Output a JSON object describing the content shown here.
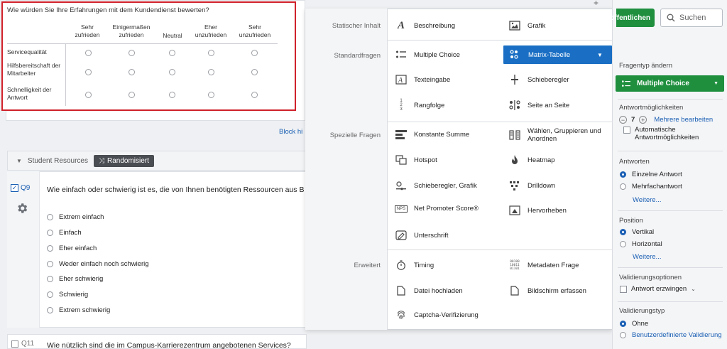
{
  "toolbar": {
    "publish_label": "öffentlichen",
    "search_label": "Suchen"
  },
  "preview": {
    "question": "Wie würden Sie Ihre Erfahrungen mit dem Kundendienst bewerten?",
    "columns": [
      "Sehr zufrieden",
      "Einigermaßen zufrieden",
      "Neutral",
      "Eher unzufrieden",
      "Sehr unzufrieden"
    ],
    "rows": [
      "Servicequalität",
      "Hilfsbereitschaft der Mitarbeiter",
      "Schnelligkeit der Antwort"
    ]
  },
  "background_survey": {
    "block_link": "Block hi",
    "block_title": "Student Resources",
    "randomized_label": "Randomisiert",
    "q9": {
      "number": "Q9",
      "text": "Wie einfach oder schwierig ist es, die von Ihnen benötigten Ressourcen aus Bibliothekssystem zu beziehen?",
      "options": [
        "Extrem einfach",
        "Einfach",
        "Eher einfach",
        "Weder einfach noch schwierig",
        "Eher schwierig",
        "Schwierig",
        "Extrem schwierig"
      ]
    },
    "q11": {
      "number": "Q11",
      "text": "Wie nützlich sind die im Campus-Karrierezentrum angebotenen Services?"
    }
  },
  "question_type_panel": {
    "categories": {
      "static": "Statischer Inhalt",
      "standard": "Standardfragen",
      "special": "Spezielle Fragen",
      "advanced": "Erweitert"
    },
    "static_items": [
      "Beschreibung",
      "Grafik"
    ],
    "standard_items": [
      "Multiple Choice",
      "Matrix-Tabelle",
      "Texteingabe",
      "Schieberegler",
      "Rangfolge",
      "Seite an Seite"
    ],
    "special_items": [
      "Konstante Summe",
      "Wählen, Gruppieren und Anordnen",
      "Hotspot",
      "Heatmap",
      "Schieberegler, Grafik",
      "Drilldown",
      "Net Promoter Score®",
      "Hervorheben",
      "Unterschrift"
    ],
    "advanced_items": [
      "Timing",
      "Metadaten Frage",
      "Datei hochladen",
      "Bildschirm erfassen",
      "Captcha-Verifizierung"
    ],
    "selected": "Matrix-Tabelle"
  },
  "sidebar": {
    "question_type_label": "Fragentyp ändern",
    "question_type_value": "Multiple Choice",
    "choices_label": "Antwortmöglichkeiten",
    "choices_count": "7",
    "edit_multiple": "Mehrere bearbeiten",
    "auto_choices": "Automatische Antwortmöglichkeiten",
    "answers_label": "Antworten",
    "single_answer": "Einzelne Antwort",
    "multiple_answer": "Mehrfachantwort",
    "more1": "Weitere...",
    "position_label": "Position",
    "vertical": "Vertikal",
    "horizontal": "Horizontal",
    "more2": "Weitere...",
    "validation_options_label": "Validierungsoptionen",
    "force_answer": "Antwort erzwingen",
    "validation_type_label": "Validierungstyp",
    "none": "Ohne",
    "custom_validation": "Benutzerdefinierte Validierung"
  }
}
